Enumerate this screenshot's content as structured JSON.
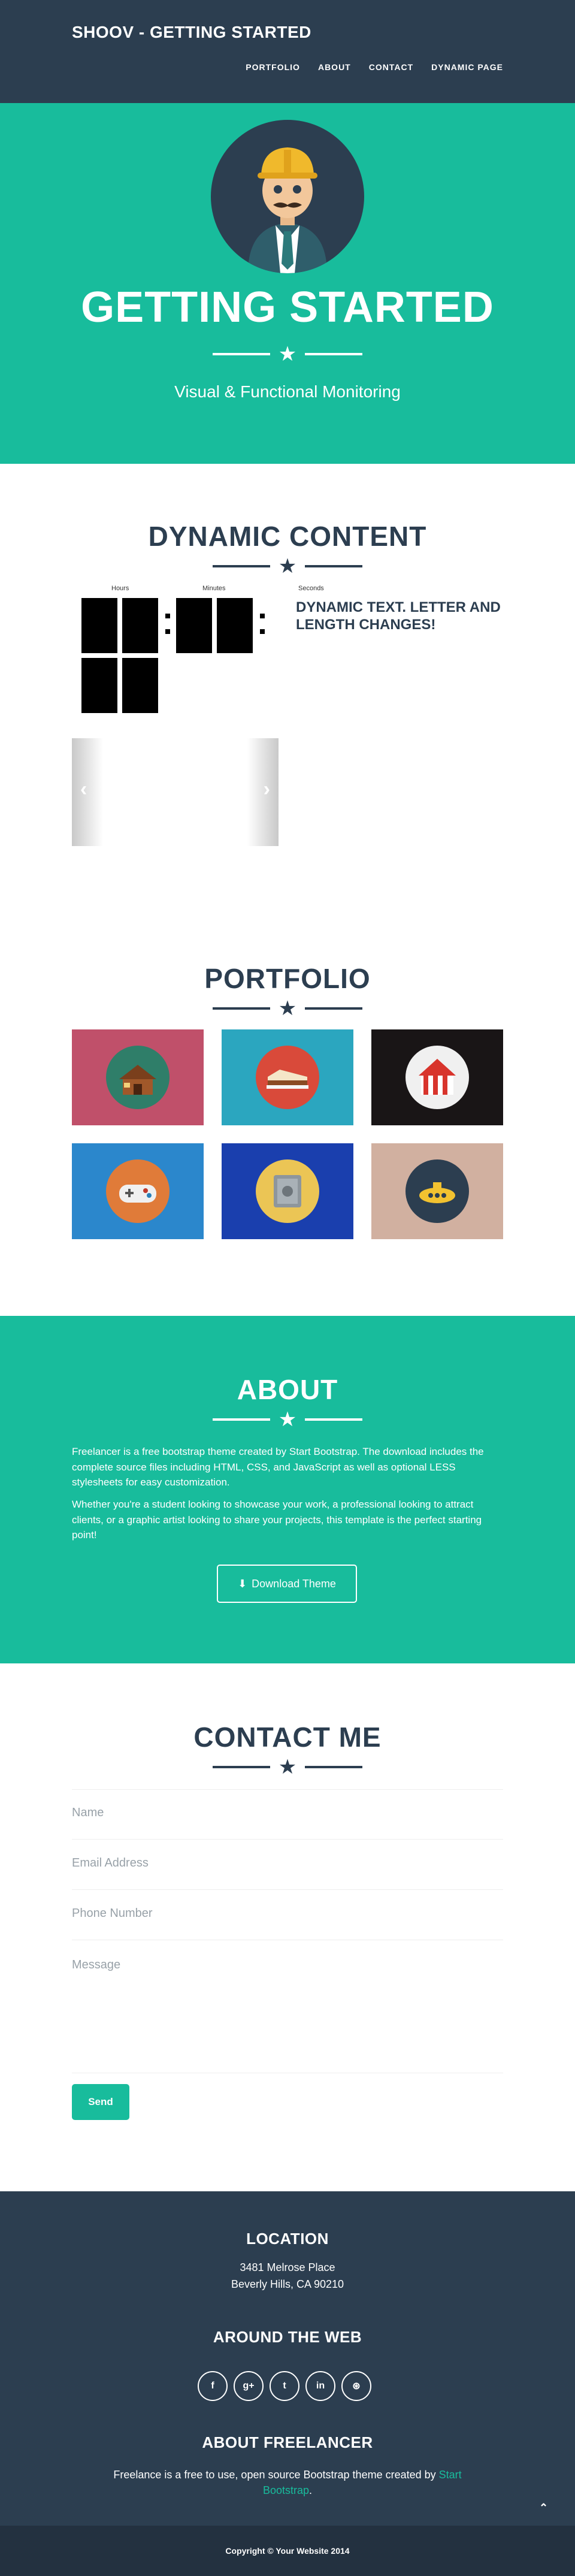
{
  "nav": {
    "brand": "SHOOV - GETTING STARTED",
    "links": [
      {
        "label": "PORTFOLIO"
      },
      {
        "label": "ABOUT"
      },
      {
        "label": "CONTACT"
      },
      {
        "label": "DYNAMIC PAGE"
      }
    ]
  },
  "header": {
    "title": "GETTING STARTED",
    "subtitle": "Visual & Functional Monitoring",
    "divider_icon": "star-icon"
  },
  "dynamic": {
    "title": "DYNAMIC CONTENT",
    "clock_labels": {
      "hours": "Hours",
      "minutes": "Minutes",
      "seconds": "Seconds"
    },
    "text": "DYNAMIC TEXT. LETTER AND LENGTH CHANGES!",
    "carousel": {
      "prev_icon": "chevron-left-icon",
      "next_icon": "chevron-right-icon"
    }
  },
  "portfolio": {
    "title": "PORTFOLIO",
    "items": [
      {
        "name": "cabin",
        "bg": "#c0506a",
        "disc": "#2f7e69",
        "icon": "cabin-icon"
      },
      {
        "name": "cake",
        "bg": "#2ba6bf",
        "disc": "#d94a3a",
        "icon": "cake-icon"
      },
      {
        "name": "circus",
        "bg": "#191516",
        "disc": "#f0f0f0",
        "icon": "circus-tent-icon"
      },
      {
        "name": "game",
        "bg": "#2b87cc",
        "disc": "#e07b39",
        "icon": "game-controller-icon"
      },
      {
        "name": "safe",
        "bg": "#1a3fae",
        "disc": "#ebc555",
        "icon": "safe-icon"
      },
      {
        "name": "submarine",
        "bg": "#d1b0a0",
        "disc": "#2c3e50",
        "icon": "submarine-icon"
      }
    ]
  },
  "about": {
    "title": "ABOUT",
    "paragraph1": "Freelancer is a free bootstrap theme created by Start Bootstrap. The download includes the complete source files including HTML, CSS, and JavaScript as well as optional LESS stylesheets for easy customization.",
    "paragraph2": "Whether you're a student looking to showcase your work, a professional looking to attract clients, or a graphic artist looking to share your projects, this template is the perfect starting point!",
    "download_label": "Download Theme"
  },
  "contact": {
    "title": "CONTACT ME",
    "name_placeholder": "Name",
    "email_placeholder": "Email Address",
    "phone_placeholder": "Phone Number",
    "message_placeholder": "Message",
    "send_label": "Send"
  },
  "footer": {
    "location_title": "LOCATION",
    "address_line1": "3481 Melrose Place",
    "address_line2": "Beverly Hills, CA 90210",
    "web_title": "AROUND THE WEB",
    "socials": [
      {
        "glyph": "f",
        "icon": "facebook-icon"
      },
      {
        "glyph": "g+",
        "icon": "google-plus-icon"
      },
      {
        "glyph": "t",
        "icon": "twitter-icon"
      },
      {
        "glyph": "in",
        "icon": "linkedin-icon"
      },
      {
        "glyph": "⊛",
        "icon": "dribbble-icon"
      }
    ],
    "freelancer_title": "ABOUT FREELANCER",
    "freelancer_text": "Freelance is a free to use, open source Bootstrap theme created by",
    "freelancer_link": "Start Bootstrap",
    "freelancer_end": ".",
    "to_top_icon": "chevron-up-icon"
  },
  "copyright": "Copyright © Your Website 2014"
}
